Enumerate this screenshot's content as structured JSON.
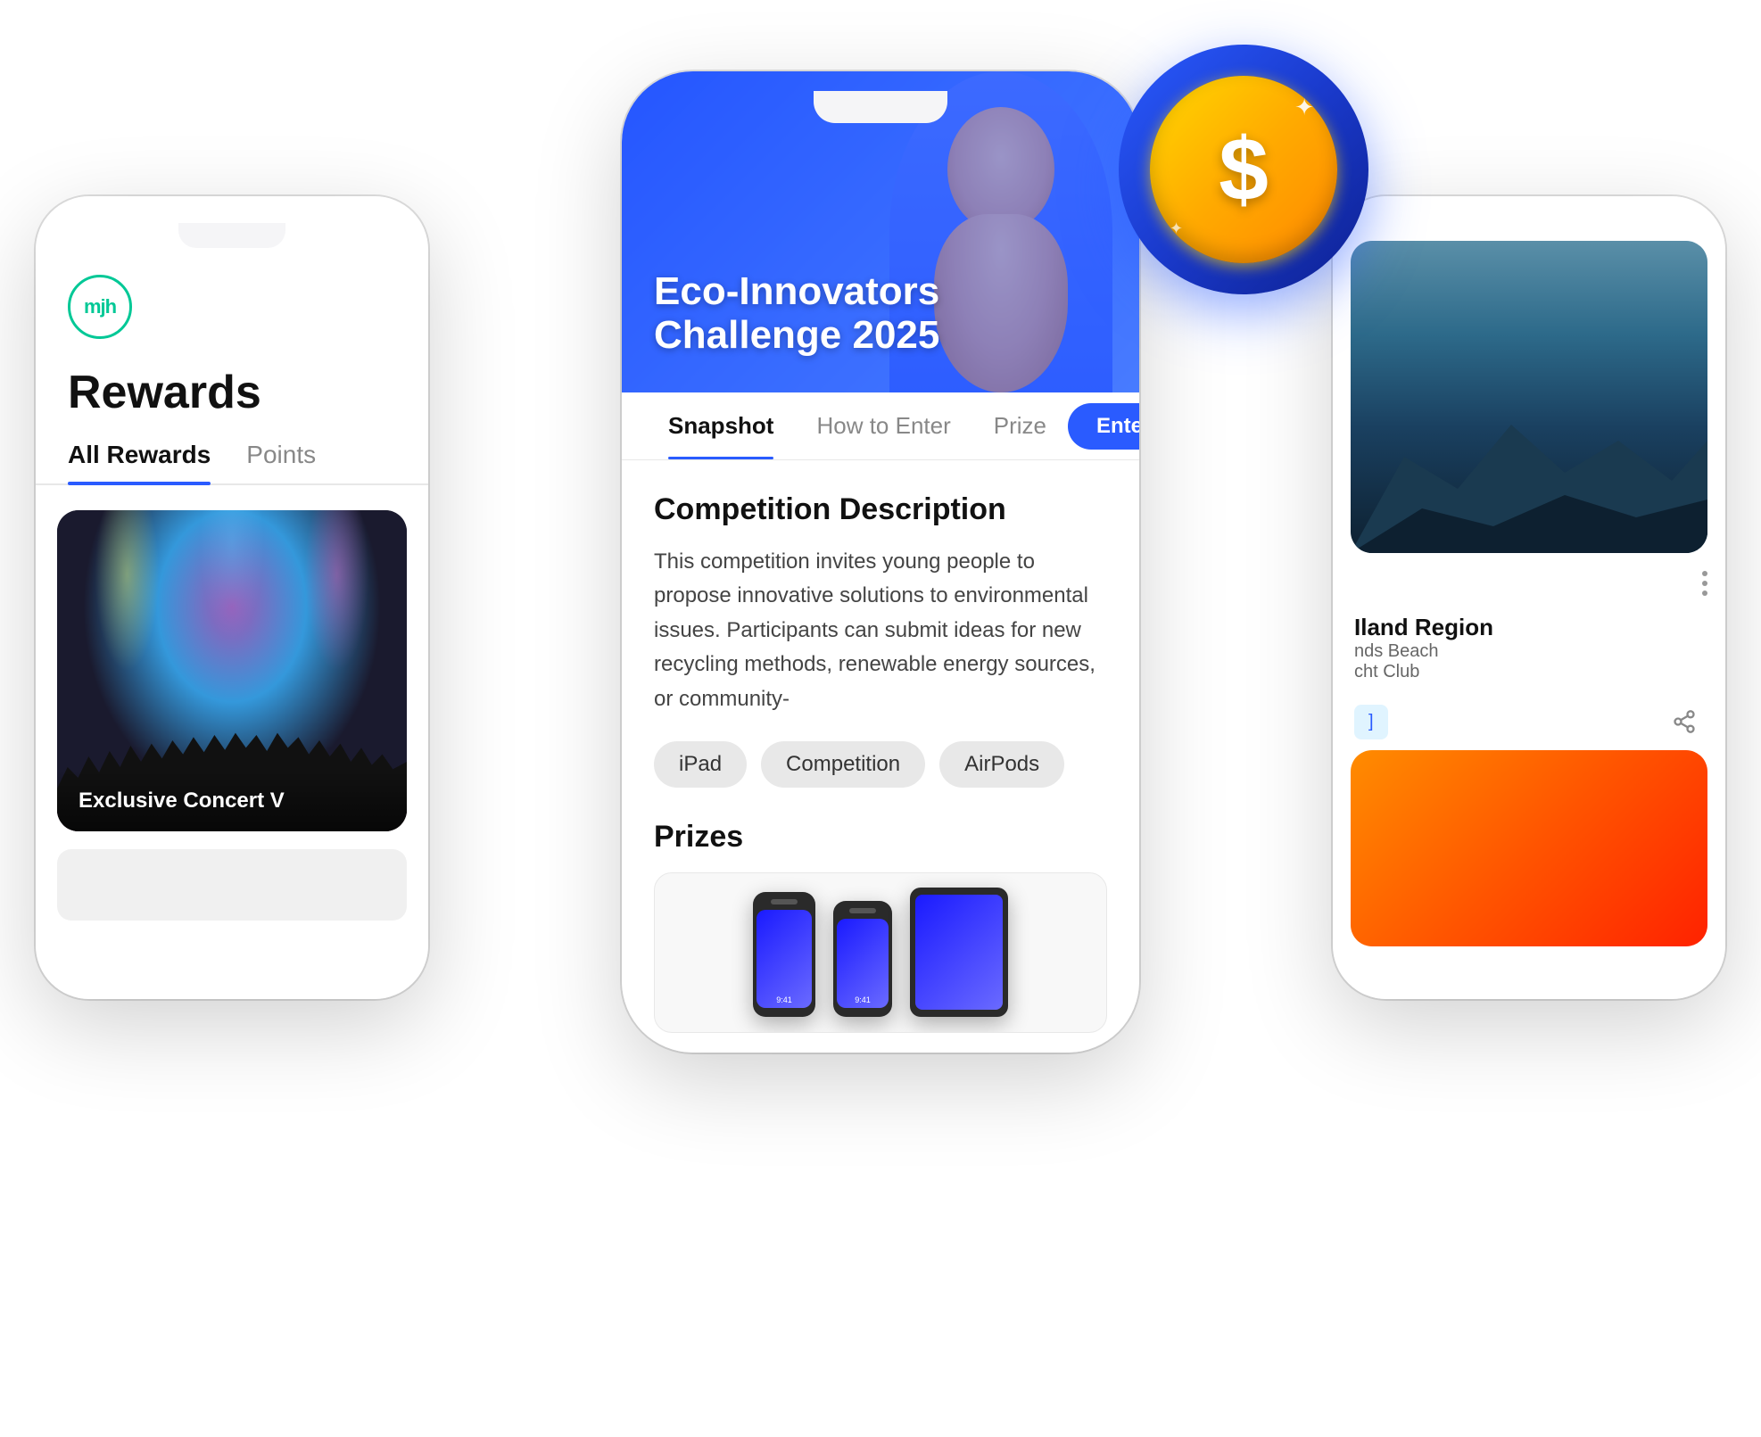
{
  "scene": {
    "bg_color": "#ffffff"
  },
  "left_phone": {
    "logo_text": "mjh",
    "title": "Rewards",
    "tabs": [
      {
        "label": "All Rewards",
        "active": true
      },
      {
        "label": "Points",
        "active": false
      }
    ],
    "card_label": "Exclusive Concert V"
  },
  "center_phone": {
    "hero": {
      "title_line1": "Eco-Innovators",
      "title_line2": "Challenge 2025"
    },
    "nav_tabs": [
      {
        "label": "Snapshot",
        "active": true
      },
      {
        "label": "How to Enter",
        "active": false
      },
      {
        "label": "Prize",
        "active": false
      }
    ],
    "enter_button": "Enter Now",
    "competition_section": {
      "title": "Competition Description",
      "body": "This competition invites young people to propose innovative solutions to environmental issues. Participants can submit ideas for new recycling methods, renewable energy sources, or community-"
    },
    "tags": [
      "iPad",
      "Competition",
      "AirPods"
    ],
    "prizes_title": "Prizes"
  },
  "right_phone": {
    "card_title": "Iland Region",
    "card_sub1": "nds Beach",
    "card_sub2": "cht Club",
    "action_tag": "]",
    "share_icon": "share"
  },
  "coin": {
    "symbol": "$"
  }
}
